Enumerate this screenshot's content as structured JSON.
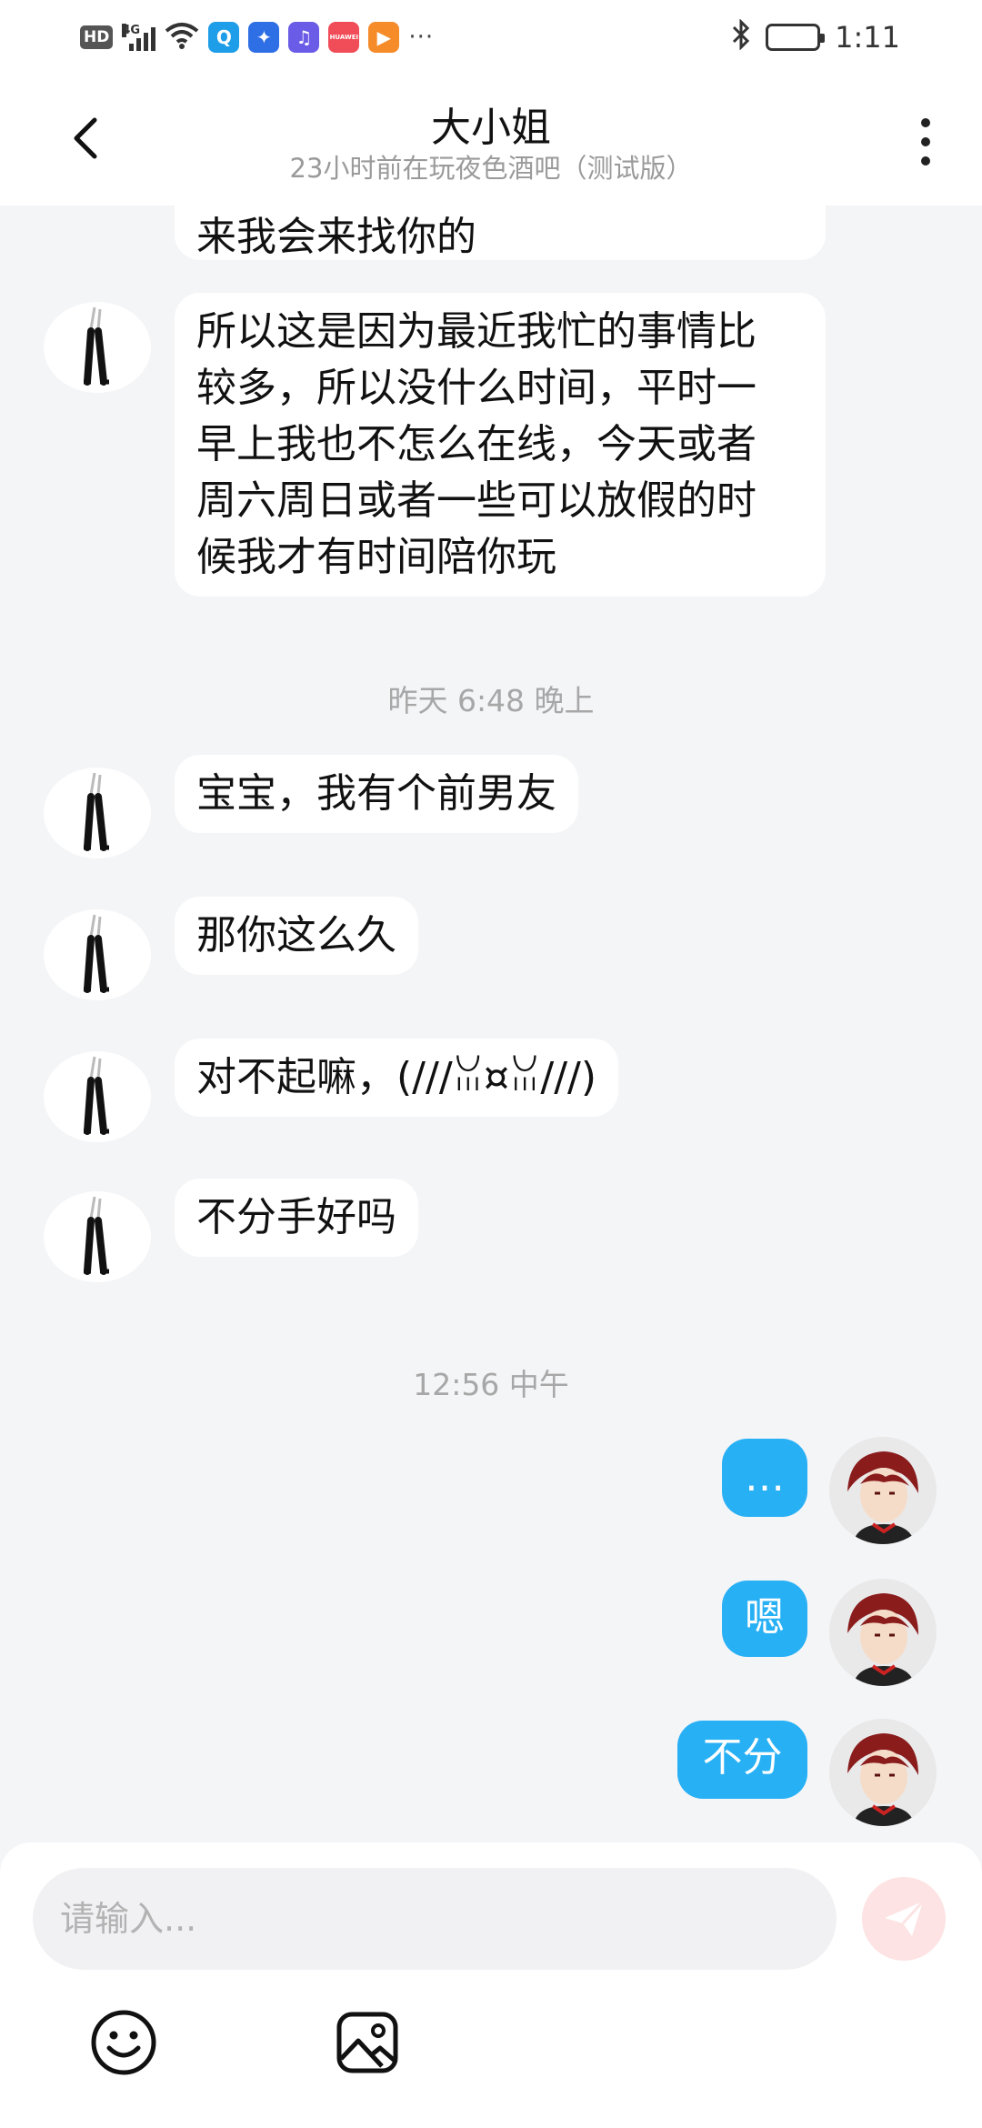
{
  "status_bar": {
    "hd": "HD",
    "network": "4G",
    "time": "1:11",
    "apps": [
      {
        "icon": "search-app-icon",
        "color": "#1e9ee8",
        "glyph": "Q"
      },
      {
        "icon": "bulb-app-icon",
        "color": "#2f6fe6",
        "glyph": "✦"
      },
      {
        "icon": "music-app-icon",
        "color": "#6a5ce6",
        "glyph": "♫"
      },
      {
        "icon": "huawei-app-icon",
        "color": "#f04d58",
        "glyph": "HUAWEI"
      },
      {
        "icon": "video-app-icon",
        "color": "#f68b2a",
        "glyph": "▶"
      }
    ],
    "more": "···"
  },
  "header": {
    "title": "大小姐",
    "subtitle": "23小时前在玩夜色酒吧（测试版）",
    "back_icon": "chevron-left-icon",
    "more_icon": "more-vertical-icon"
  },
  "messages": [
    {
      "from": "her",
      "text": "来我会来找你的"
    },
    {
      "from": "her",
      "text": "所以这是因为最近我忙的事情比\n较多，所以没什么时间，平时一\n早上我也不怎么在线，今天或者\n周六周日或者一些可以放假的时\n候我才有时间陪你玩"
    },
    {
      "type": "timestamp",
      "text": "昨天 6:48 晚上"
    },
    {
      "from": "her",
      "text": "宝宝，我有个前男友"
    },
    {
      "from": "her",
      "text": "那你这么久"
    },
    {
      "from": "her",
      "text": "对不起嘛，(///ꈍ¤ꈍ///)"
    },
    {
      "from": "her",
      "text": "不分手好吗"
    },
    {
      "type": "timestamp",
      "text": "12:56 中午"
    },
    {
      "from": "me",
      "text": "…"
    },
    {
      "from": "me",
      "text": "嗯"
    },
    {
      "from": "me",
      "text": "不分"
    }
  ],
  "input": {
    "placeholder": "请输入...",
    "value": "",
    "send_icon": "send-icon",
    "emoji_icon": "smiley-icon",
    "image_icon": "image-icon"
  },
  "colors": {
    "my_bubble": "#28b0f5",
    "her_bubble": "#ffffff",
    "chat_bg": "#f4f5f7",
    "send_bg": "#fde3e3"
  }
}
